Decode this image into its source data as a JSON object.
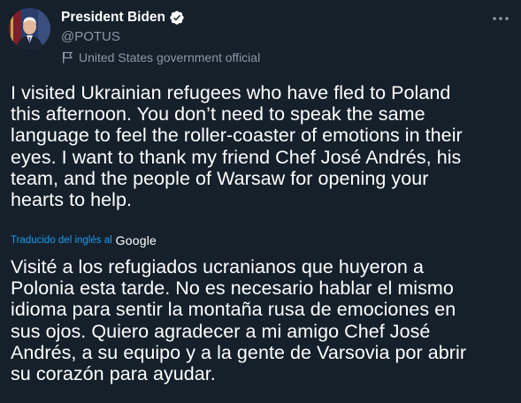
{
  "author": {
    "display_name": "President Biden",
    "handle": "@POTUS",
    "label": "United States government official",
    "avatar_icon": "avatar-portrait",
    "verified_icon": "verified-badge-icon",
    "label_icon": "flag-icon"
  },
  "menu": {
    "icon": "more-options-icon"
  },
  "tweet": {
    "text": "I visited Ukrainian refugees who have fled to Poland\nthis afternoon. You don’t need to speak the same\nlanguage to feel the roller-coaster of emotions in their\neyes. I want to thank my friend Chef José Andrés, his\nteam, and the people of Warsaw for opening your\nhearts to help."
  },
  "translation": {
    "credit": "Traducido del inglés al",
    "provider": "Google",
    "text": "Visité a los refugiados ucranianos que huyeron a\nPolonia esta tarde. No es necesario hablar el mismo\nidioma para sentir la montaña rusa de emociones en\nsus ojos. Quiero agradecer a mi amigo Chef José\nAndrés, a su equipo y a la gente de Varsovia por abrir\nsu corazón para ayudar."
  },
  "colors": {
    "background": "#15202b",
    "text_primary": "#ffffff",
    "text_secondary": "#8b98a5",
    "accent": "#1d9bf0"
  }
}
